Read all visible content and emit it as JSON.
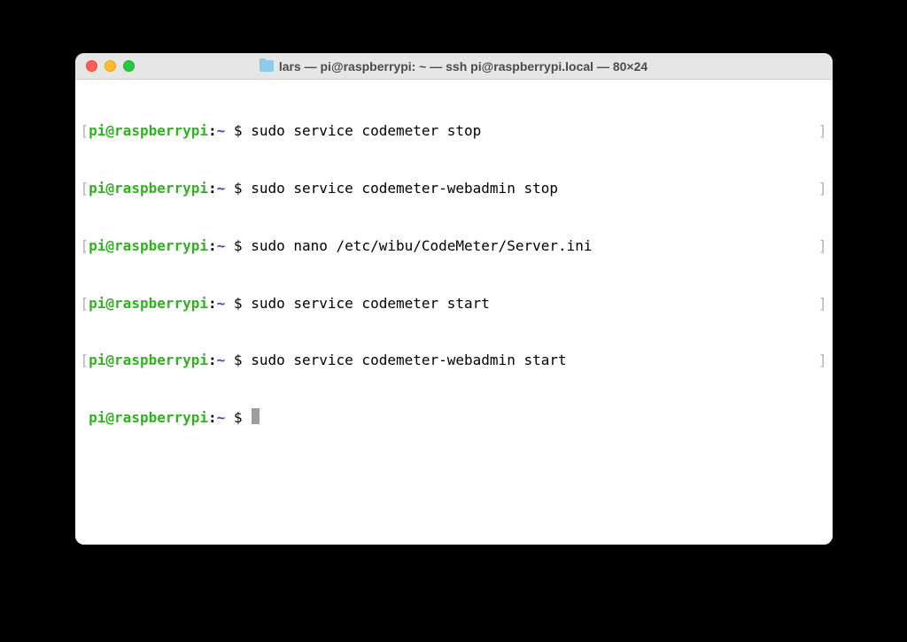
{
  "window": {
    "title": "lars — pi@raspberrypi: ~ — ssh pi@raspberrypi.local — 80×24"
  },
  "prompt": {
    "open": "[",
    "user": "pi",
    "at": "@",
    "host": "raspberrypi",
    "colon": ":",
    "path": "~",
    "dollar": " $ ",
    "close": "]"
  },
  "lines": [
    {
      "cmd": "sudo service codemeter stop"
    },
    {
      "cmd": "sudo service codemeter-webadmin stop"
    },
    {
      "cmd": "sudo nano /etc/wibu/CodeMeter/Server.ini"
    },
    {
      "cmd": "sudo service codemeter start"
    },
    {
      "cmd": "sudo service codemeter-webadmin start"
    }
  ],
  "current": {
    "leading_space": " "
  }
}
